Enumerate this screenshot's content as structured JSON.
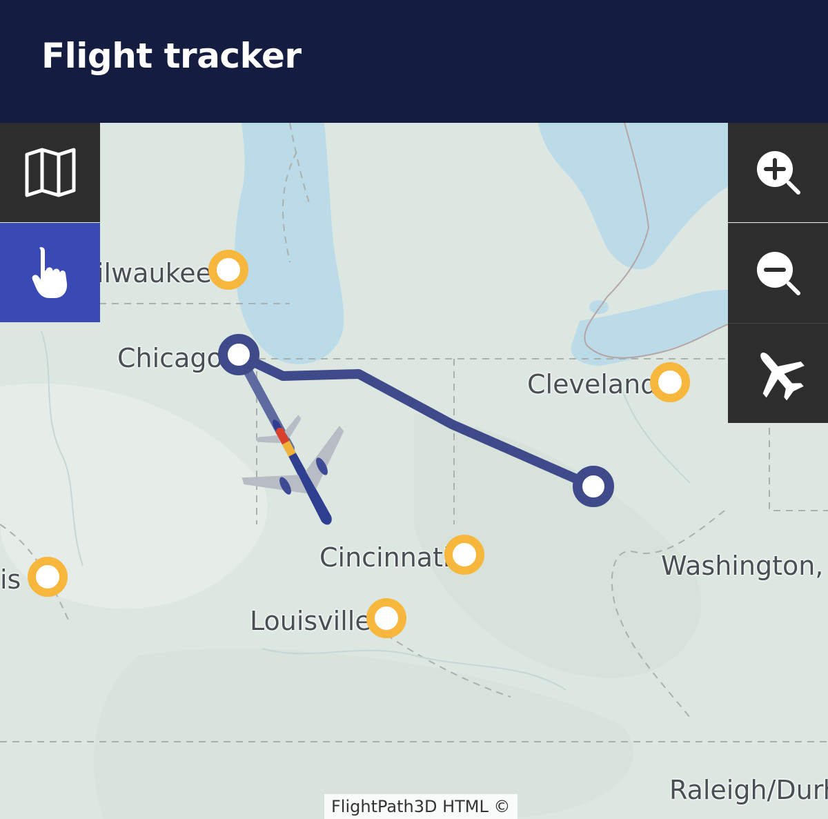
{
  "app": {
    "title": "Flight tracker"
  },
  "map": {
    "cities": [
      {
        "name": "ilwaukee",
        "marker": "yellow-ring"
      },
      {
        "name": "Chicago",
        "marker": "route-endpoint"
      },
      {
        "name": "Cleveland",
        "marker": "yellow-ring"
      },
      {
        "name": "Cincinnati",
        "marker": "yellow-ring"
      },
      {
        "name": "is",
        "marker": "yellow-ring"
      },
      {
        "name": "Louisville",
        "marker": "yellow-ring"
      },
      {
        "name": "Washington, D",
        "marker": "none"
      },
      {
        "name": "Raleigh/Durh",
        "marker": "none"
      }
    ],
    "route_color": "#3e4a8a",
    "city_marker_color": "#f6b73c",
    "attribution": "FlightPath3D HTML ©"
  },
  "left_toolbar": {
    "buttons": [
      {
        "icon": "map-icon",
        "active": false
      },
      {
        "icon": "hand-pointer-icon",
        "active": true
      }
    ],
    "active_color": "#3a4ab5"
  },
  "right_toolbar": {
    "buttons": [
      {
        "icon": "zoom-in-icon"
      },
      {
        "icon": "zoom-out-icon"
      },
      {
        "icon": "airplane-icon"
      }
    ]
  },
  "colors": {
    "header_bg": "#141c40",
    "toolbar_bg": "#2d2d2d"
  }
}
